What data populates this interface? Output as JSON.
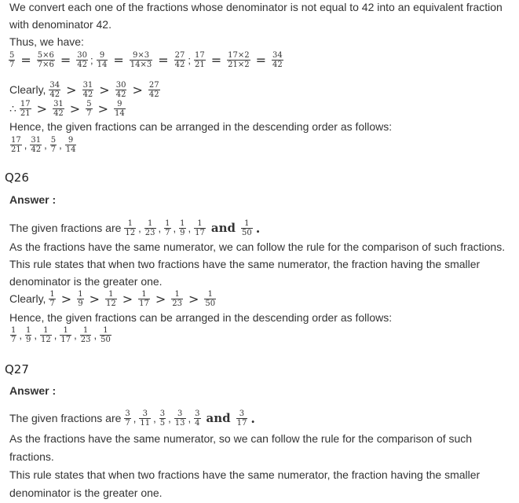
{
  "part1": {
    "intro_line1": "We convert each one of the fractions whose denominator is not equal to 42 into an equivalent fraction",
    "intro_line2": "with denominator 42.",
    "thus": "Thus, we have:",
    "conv": {
      "f1": {
        "n": "5",
        "d": "7"
      },
      "f1b": {
        "n": "5×6",
        "d": "7×6"
      },
      "f1c": {
        "n": "30",
        "d": "42"
      },
      "f2": {
        "n": "9",
        "d": "14"
      },
      "f2b": {
        "n": "9×3",
        "d": "14×3"
      },
      "f2c": {
        "n": "27",
        "d": "42"
      },
      "f3": {
        "n": "17",
        "d": "21"
      },
      "f3b": {
        "n": "17×2",
        "d": "21×2"
      },
      "f3c": {
        "n": "34",
        "d": "42"
      }
    },
    "clearly_label": "Clearly,",
    "clearly": [
      {
        "n": "34",
        "d": "42"
      },
      {
        "n": "31",
        "d": "42"
      },
      {
        "n": "30",
        "d": "42"
      },
      {
        "n": "27",
        "d": "42"
      }
    ],
    "therefore_symbol": "∴",
    "therefore": [
      {
        "n": "17",
        "d": "21"
      },
      {
        "n": "31",
        "d": "42"
      },
      {
        "n": "5",
        "d": "7"
      },
      {
        "n": "9",
        "d": "14"
      }
    ],
    "hence": "Hence, the given fractions can be arranged in the descending order as follows:",
    "order": [
      {
        "n": "17",
        "d": "21"
      },
      {
        "n": "31",
        "d": "42"
      },
      {
        "n": "5",
        "d": "7"
      },
      {
        "n": "9",
        "d": "14"
      }
    ]
  },
  "q26": {
    "heading": "Q26",
    "answer": "Answer :",
    "given_label": "The given fractions are",
    "given": [
      {
        "n": "1",
        "d": "12"
      },
      {
        "n": "1",
        "d": "23"
      },
      {
        "n": "1",
        "d": "7"
      },
      {
        "n": "1",
        "d": "9"
      },
      {
        "n": "1",
        "d": "17"
      }
    ],
    "given_and": "and",
    "given_last": {
      "n": "1",
      "d": "50"
    },
    "rule_line1": "As the fractions have the same numerator, we can follow the rule for the comparison of such fractions.",
    "rule_line2": "This rule states that when two fractions have the same numerator, the fraction having the smaller",
    "rule_line3": "denominator is the greater one.",
    "clearly_label": "Clearly,",
    "clearly": [
      {
        "n": "1",
        "d": "7"
      },
      {
        "n": "1",
        "d": "9"
      },
      {
        "n": "1",
        "d": "12"
      },
      {
        "n": "1",
        "d": "17"
      },
      {
        "n": "1",
        "d": "23"
      },
      {
        "n": "1",
        "d": "50"
      }
    ],
    "hence": "Hence, the given fractions can be arranged in the descending order as follows:",
    "order": [
      {
        "n": "1",
        "d": "7"
      },
      {
        "n": "1",
        "d": "9"
      },
      {
        "n": "1",
        "d": "12"
      },
      {
        "n": "1",
        "d": "17"
      },
      {
        "n": "1",
        "d": "23"
      },
      {
        "n": "1",
        "d": "50"
      }
    ]
  },
  "q27": {
    "heading": "Q27",
    "answer": "Answer :",
    "given_label": "The given fractions are",
    "given": [
      {
        "n": "3",
        "d": "7"
      },
      {
        "n": "3",
        "d": "11"
      },
      {
        "n": "3",
        "d": "5"
      },
      {
        "n": "3",
        "d": "13"
      },
      {
        "n": "3",
        "d": "4"
      }
    ],
    "given_and": "and",
    "given_last": {
      "n": "3",
      "d": "17"
    },
    "rule_line1": "As the fractions have the same numerator, so we can follow the rule for the comparison of such",
    "rule_line2": "fractions.",
    "rule_line3": "This rule states that when two fractions have the same numerator, the fraction having the smaller",
    "rule_line4": "denominator is the greater one."
  }
}
